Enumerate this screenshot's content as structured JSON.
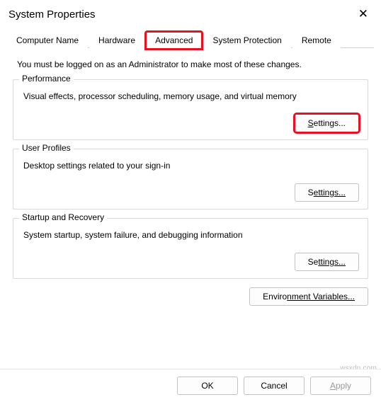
{
  "title": "System Properties",
  "tabs": [
    {
      "label": "Computer Name"
    },
    {
      "label": "Hardware"
    },
    {
      "label": "Advanced"
    },
    {
      "label": "System Protection"
    },
    {
      "label": "Remote"
    }
  ],
  "note": "You must be logged on as an Administrator to make most of these changes.",
  "groups": {
    "performance": {
      "legend": "Performance",
      "desc": "Visual effects, processor scheduling, memory usage, and virtual memory",
      "button_prefix": "S",
      "button_rest": "ettings..."
    },
    "userProfiles": {
      "legend": "User Profiles",
      "desc": "Desktop settings related to your sign-in",
      "button_prefix": "S",
      "button_rest": "ettings..."
    },
    "startup": {
      "legend": "Startup and Recovery",
      "desc": "System startup, system failure, and debugging information",
      "button_prefix": "Se",
      "button_rest": "ttings..."
    }
  },
  "envBtn": {
    "prefix": "Enviro",
    "rest": "nment Variables..."
  },
  "footer": {
    "ok": "OK",
    "cancel": "Cancel",
    "apply_prefix": "A",
    "apply_rest": "pply"
  },
  "watermark": "wsxdn.com"
}
